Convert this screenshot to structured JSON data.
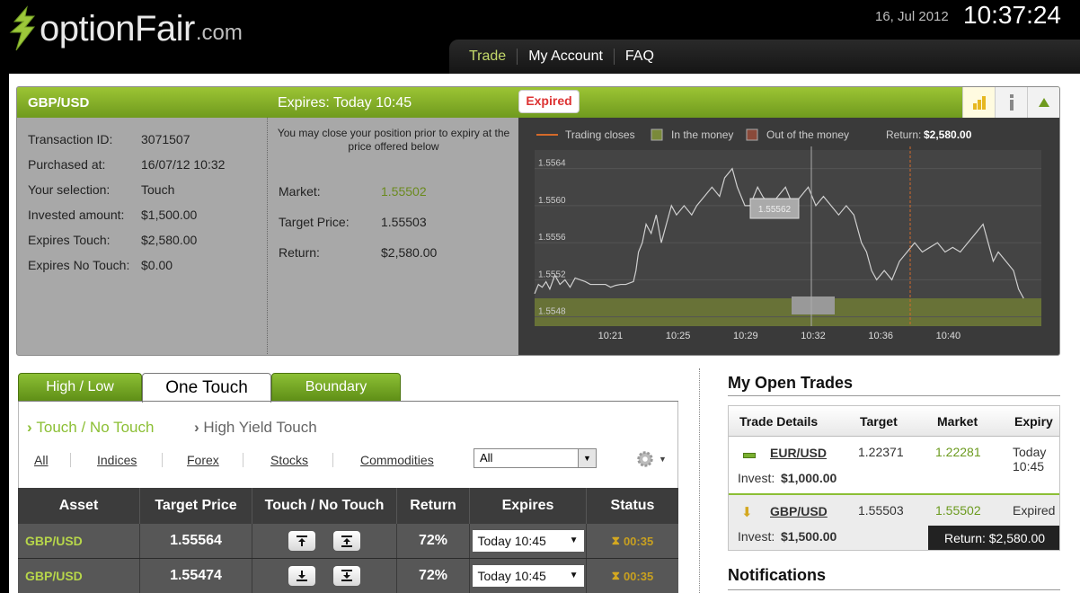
{
  "header": {
    "logo_text": "optionFair",
    "logo_suffix": ".com",
    "date": "16, Jul 2012",
    "time": "10:37:24",
    "nav": [
      "Trade",
      "My Account",
      "FAQ"
    ]
  },
  "trade_panel": {
    "pair": "GBP/USD",
    "expires": "Expires:  Today 10:45",
    "badge": "Expired",
    "details": [
      {
        "label": "Transaction ID:",
        "value": "3071507"
      },
      {
        "label": "Purchased at:",
        "value": "16/07/12 10:32"
      },
      {
        "label": "Your selection:",
        "value": "Touch"
      },
      {
        "label": "Invested amount:",
        "value": "$1,500.00"
      },
      {
        "label": "Expires Touch:",
        "value": "$2,580.00"
      },
      {
        "label": "Expires No Touch:",
        "value": "$0.00"
      }
    ],
    "note": "You may close your position prior to expiry at the price offered below",
    "market_label": "Market:",
    "market_value": "1.55502",
    "target_label": "Target Price:",
    "target_value": "1.55503",
    "return_label": "Return:",
    "return_value": "$2,580.00"
  },
  "chart_data": {
    "type": "line",
    "legend": [
      "Trading closes",
      "In the money",
      "Out of the money"
    ],
    "return_label": "Return:",
    "return_value": "$2,580.00",
    "y_ticks": [
      "1.5564",
      "1.5560",
      "1.5556",
      "1.5552",
      "1.5548"
    ],
    "x_ticks": [
      "10:21",
      "10:25",
      "10:29",
      "10:32",
      "10:36",
      "10:40"
    ],
    "marker_value": "1.55562",
    "ylim": [
      1.5547,
      1.5566
    ],
    "in_the_money_band": [
      1.5547,
      1.555
    ],
    "series": [
      {
        "values": [
          [
            0,
            1.55505
          ],
          [
            3,
            1.55515
          ],
          [
            6,
            1.55512
          ],
          [
            9,
            1.55518
          ],
          [
            12,
            1.5551
          ],
          [
            16,
            1.55525
          ],
          [
            20,
            1.55515
          ],
          [
            24,
            1.5552
          ],
          [
            28,
            1.55512
          ],
          [
            32,
            1.55522
          ],
          [
            36,
            1.5552
          ],
          [
            40,
            1.55518
          ],
          [
            44,
            1.55515
          ],
          [
            48,
            1.55515
          ],
          [
            52,
            1.55515
          ],
          [
            56,
            1.55515
          ],
          [
            60,
            1.55512
          ],
          [
            64,
            1.55514
          ],
          [
            68,
            1.55515
          ],
          [
            72,
            1.55515
          ],
          [
            78,
            1.55518
          ],
          [
            80,
            1.5553
          ],
          [
            82,
            1.5555
          ],
          [
            85,
            1.5556
          ],
          [
            88,
            1.5558
          ],
          [
            92,
            1.5557
          ],
          [
            96,
            1.5559
          ],
          [
            100,
            1.5556
          ],
          [
            104,
            1.5558
          ],
          [
            108,
            1.556
          ],
          [
            112,
            1.5559
          ],
          [
            118,
            1.556
          ],
          [
            124,
            1.5559
          ],
          [
            128,
            1.556
          ],
          [
            134,
            1.5561
          ],
          [
            140,
            1.5562
          ],
          [
            146,
            1.5561
          ],
          [
            150,
            1.5563
          ],
          [
            156,
            1.5564
          ],
          [
            160,
            1.5562
          ],
          [
            166,
            1.556
          ],
          [
            170,
            1.556
          ],
          [
            176,
            1.5562
          ],
          [
            180,
            1.5561
          ],
          [
            186,
            1.556
          ],
          [
            192,
            1.5561
          ],
          [
            198,
            1.5562
          ],
          [
            204,
            1.556
          ],
          [
            210,
            1.5561
          ],
          [
            216,
            1.5562
          ],
          [
            222,
            1.556
          ],
          [
            228,
            1.5561
          ],
          [
            234,
            1.556
          ],
          [
            240,
            1.5559
          ],
          [
            246,
            1.556
          ],
          [
            252,
            1.5559
          ],
          [
            258,
            1.5556
          ],
          [
            262,
            1.5555
          ],
          [
            266,
            1.5553
          ],
          [
            270,
            1.5552
          ],
          [
            276,
            1.5553
          ],
          [
            282,
            1.5552
          ],
          [
            288,
            1.5554
          ],
          [
            294,
            1.5555
          ],
          [
            300,
            1.5556
          ],
          [
            306,
            1.5555
          ],
          [
            312,
            1.55555
          ],
          [
            318,
            1.5556
          ],
          [
            324,
            1.5555
          ],
          [
            330,
            1.55555
          ],
          [
            336,
            1.5555
          ],
          [
            342,
            1.5556
          ],
          [
            348,
            1.5557
          ],
          [
            354,
            1.5558
          ],
          [
            358,
            1.5556
          ],
          [
            362,
            1.5554
          ],
          [
            366,
            1.5555
          ],
          [
            372,
            1.5554
          ],
          [
            378,
            1.5553
          ],
          [
            382,
            1.5551
          ],
          [
            386,
            1.555
          ]
        ]
      }
    ]
  },
  "tabs": [
    "High / Low",
    "One Touch",
    "Boundary"
  ],
  "sub_tabs": [
    "Touch / No Touch",
    "High Yield Touch"
  ],
  "filters": [
    "All",
    "Indices",
    "Forex",
    "Stocks",
    "Commodities"
  ],
  "filter_select": "All",
  "table": {
    "headers": [
      "Asset",
      "Target Price",
      "Touch / No Touch",
      "Return",
      "Expires",
      "Status"
    ],
    "rows": [
      {
        "asset": "GBP/USD",
        "target": "1.55564",
        "return": "72%",
        "expires": "Today 10:45",
        "status": "00:35",
        "dir": "up"
      },
      {
        "asset": "GBP/USD",
        "target": "1.55474",
        "return": "72%",
        "expires": "Today 10:45",
        "status": "00:35",
        "dir": "down"
      }
    ]
  },
  "open_trades": {
    "title": "My Open Trades",
    "headers": [
      "Trade Details",
      "Target",
      "Market",
      "Expiry"
    ],
    "rows": [
      {
        "pair": "EUR/USD",
        "invest_label": "Invest:",
        "invest": "$1,000.00",
        "target": "1.22371",
        "market": "1.22281",
        "expiry": "Today 10:45"
      },
      {
        "pair": "GBP/USD",
        "invest_label": "Invest:",
        "invest": "$1,500.00",
        "target": "1.55503",
        "market": "1.55502",
        "expiry": "Expired",
        "return": "Return: $2,580.00"
      }
    ]
  },
  "notifications_title": "Notifications",
  "colors": {
    "brand_green": "#8cbf35",
    "dark_bg": "#000000",
    "accent_yellow": "#c8a020"
  }
}
